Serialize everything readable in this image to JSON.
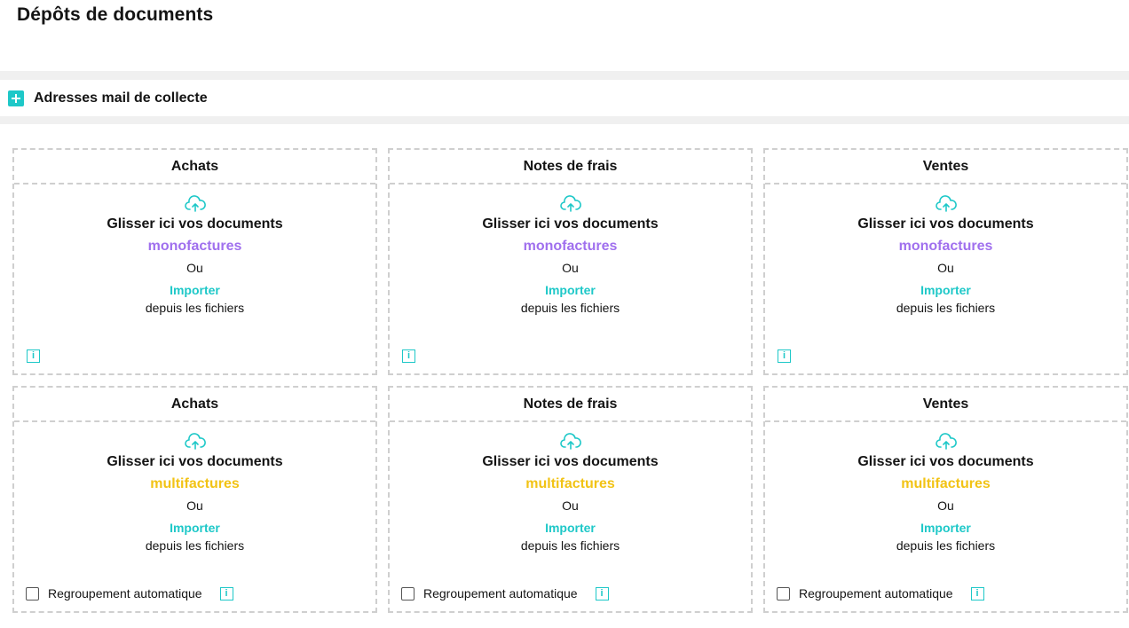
{
  "page": {
    "title": "Dépôts de documents"
  },
  "collect": {
    "label": "Adresses mail de collecte",
    "icon": "plus-icon"
  },
  "colors": {
    "accent": "#1ec8c8",
    "mono": "#a070ee",
    "multi": "#f2c315"
  },
  "cards": [
    {
      "title": "Achats",
      "drop": "Glisser ici vos documents",
      "kind": "monofactures",
      "or": "Ou",
      "import": "Importer",
      "from": "depuis les fichiers",
      "icon": "cloud-upload-icon"
    },
    {
      "title": "Notes de frais",
      "drop": "Glisser ici vos documents",
      "kind": "monofactures",
      "or": "Ou",
      "import": "Importer",
      "from": "depuis les fichiers",
      "icon": "cloud-upload-icon"
    },
    {
      "title": "Ventes",
      "drop": "Glisser ici vos documents",
      "kind": "monofactures",
      "or": "Ou",
      "import": "Importer",
      "from": "depuis les fichiers",
      "icon": "cloud-upload-icon"
    },
    {
      "title": "Achats",
      "drop": "Glisser ici vos documents",
      "kind": "multifactures",
      "or": "Ou",
      "import": "Importer",
      "from": "depuis les fichiers",
      "auto": "Regroupement automatique",
      "auto_checked": false,
      "icon": "cloud-upload-icon"
    },
    {
      "title": "Notes de frais",
      "drop": "Glisser ici vos documents",
      "kind": "multifactures",
      "or": "Ou",
      "import": "Importer",
      "from": "depuis les fichiers",
      "auto": "Regroupement automatique",
      "auto_checked": false,
      "icon": "cloud-upload-icon"
    },
    {
      "title": "Ventes",
      "drop": "Glisser ici vos documents",
      "kind": "multifactures",
      "or": "Ou",
      "import": "Importer",
      "from": "depuis les fichiers",
      "auto": "Regroupement automatique",
      "auto_checked": false,
      "icon": "cloud-upload-icon"
    }
  ],
  "info_glyph": "i"
}
